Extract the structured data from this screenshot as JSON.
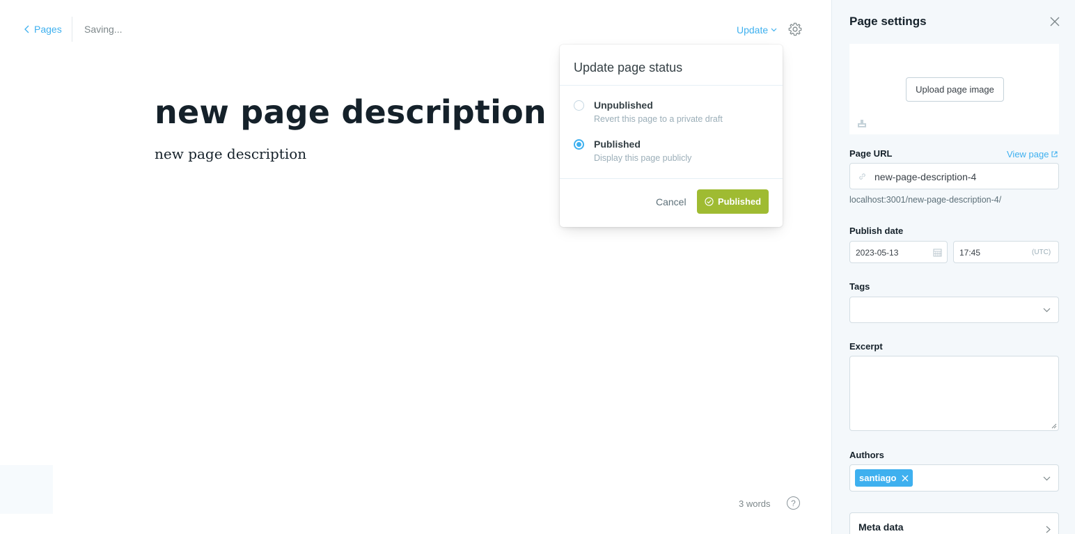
{
  "header": {
    "back_label": "Pages",
    "status": "Saving...",
    "update_label": "Update"
  },
  "editor": {
    "title": "new page description",
    "body": "new page description",
    "word_count": "3 words",
    "help_glyph": "?"
  },
  "popover": {
    "title": "Update page status",
    "options": [
      {
        "label": "Unpublished",
        "description": "Revert this page to a private draft",
        "selected": false
      },
      {
        "label": "Published",
        "description": "Display this page publicly",
        "selected": true
      }
    ],
    "cancel_label": "Cancel",
    "confirm_label": "Published"
  },
  "panel": {
    "title": "Page settings",
    "upload_label": "Upload page image",
    "url_label": "Page URL",
    "view_page_label": "View page",
    "slug": "new-page-description-4",
    "url_preview": "localhost:3001/new-page-description-4/",
    "publish_date_label": "Publish date",
    "date": "2023-05-13",
    "time": "17:45",
    "timezone": "(UTC)",
    "tags_label": "Tags",
    "excerpt_label": "Excerpt",
    "authors_label": "Authors",
    "authors": [
      "santiago"
    ],
    "meta_label": "Meta data"
  },
  "colors": {
    "accent": "#3eb0ef",
    "publish_green": "#9fbb32",
    "panel_bg": "#f4f8fb",
    "text": "#15212a"
  }
}
